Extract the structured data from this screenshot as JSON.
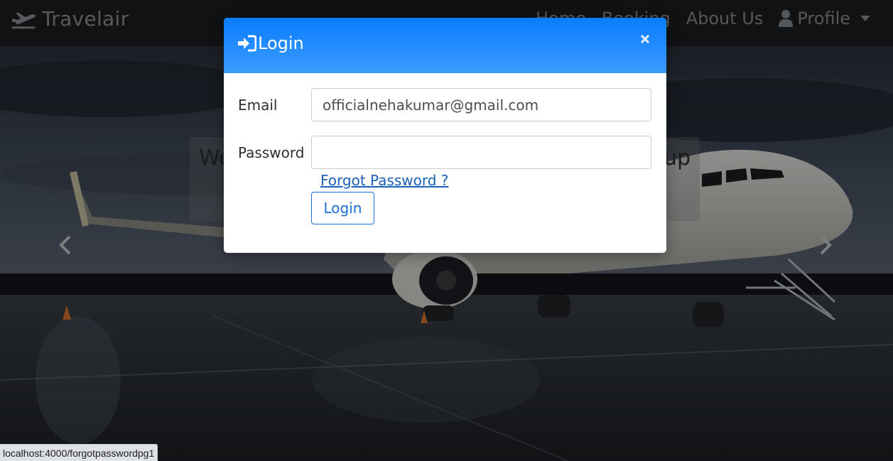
{
  "navbar": {
    "brand": "Travelair",
    "links": [
      "Home",
      "Booking",
      "About Us"
    ],
    "profile_label": "Profile"
  },
  "carousel": {
    "caption_left": "We",
    "caption_right": "up"
  },
  "modal": {
    "title": "Login",
    "email_label": "Email",
    "email_value": "officialnehakumar@gmail.com",
    "password_label": "Password",
    "password_value": "",
    "forgot_link": "Forgot Password ?",
    "login_button": "Login",
    "header_color": "#0a7cff"
  },
  "statusbar": {
    "url": "localhost:4000/forgotpasswordpg1"
  }
}
